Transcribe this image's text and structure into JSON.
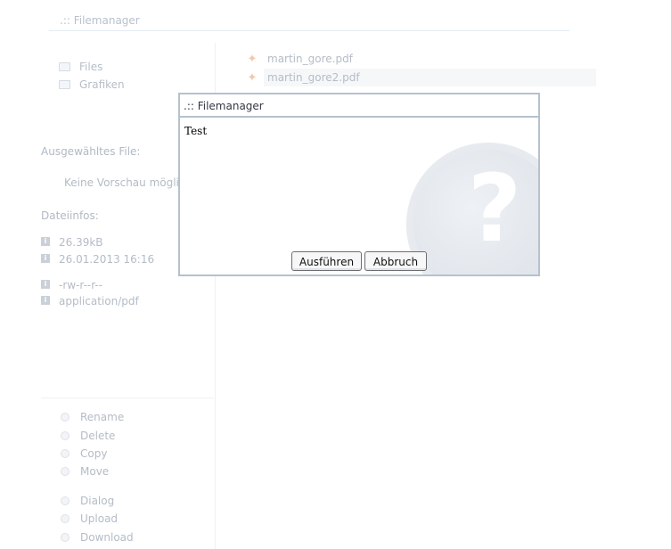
{
  "app": {
    "title": ".:: Filemanager"
  },
  "folders": [
    {
      "label": "Files",
      "icon": "folder-icon"
    },
    {
      "label": "Grafiken",
      "icon": "folder-icon"
    }
  ],
  "selected_file": {
    "heading": "Ausgewähltes File:",
    "preview_text": "Keine Vorschau möglich"
  },
  "file_info": {
    "heading": "Dateiinfos:",
    "size": "26.39kB",
    "modified": "26.01.2013 16:16",
    "permissions": "-rw-r--r--",
    "mime": "application/pdf"
  },
  "actions": [
    {
      "label": "Rename"
    },
    {
      "label": "Delete"
    },
    {
      "label": "Copy"
    },
    {
      "label": "Move"
    },
    {
      "label": "Dialog"
    },
    {
      "label": "Upload"
    },
    {
      "label": "Download"
    }
  ],
  "files": [
    {
      "name": "martin_gore.pdf",
      "selected": false,
      "icon": "pdf-icon"
    },
    {
      "name": "martin_gore2.pdf",
      "selected": true,
      "icon": "pdf-icon"
    }
  ],
  "dialog": {
    "title": ".:: Filemanager",
    "message": "Test",
    "icon": "question-icon",
    "run_label": "Ausführen",
    "cancel_label": "Abbruch"
  },
  "colors": {
    "dialog_border": "#b5c1ce",
    "faded_text": "#b5bdc7",
    "file_icon": "#f5c5ae"
  }
}
